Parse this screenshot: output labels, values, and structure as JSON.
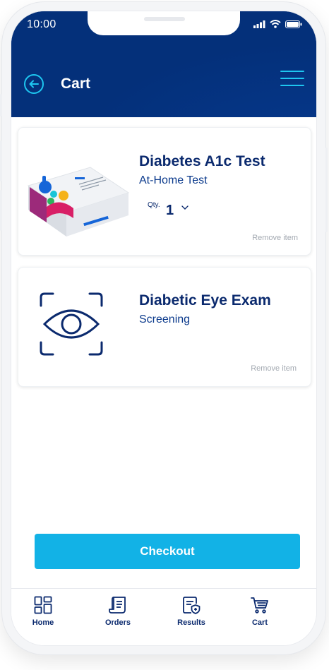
{
  "status": {
    "time": "10:00"
  },
  "header": {
    "title": "Cart"
  },
  "cart": {
    "items": [
      {
        "name": "Diabetes A1c Test",
        "subtitle": "At-Home Test",
        "qty_label": "Qty.",
        "qty_value": "1",
        "remove_label": "Remove item",
        "image_icon": "test-kit-box-icon"
      },
      {
        "name": "Diabetic Eye Exam",
        "subtitle": "Screening",
        "remove_label": "Remove item",
        "image_icon": "eye-scan-icon"
      }
    ]
  },
  "checkout": {
    "label": "Checkout"
  },
  "nav": {
    "items": [
      {
        "label": "Home",
        "icon": "grid-icon"
      },
      {
        "label": "Orders",
        "icon": "scroll-icon"
      },
      {
        "label": "Results",
        "icon": "document-shield-icon"
      },
      {
        "label": "Cart",
        "icon": "cart-icon"
      }
    ]
  },
  "colors": {
    "header_bg": "#04307a",
    "accent": "#12b2e6",
    "text_primary": "#0b2a6e",
    "muted": "#a3a9b1"
  }
}
